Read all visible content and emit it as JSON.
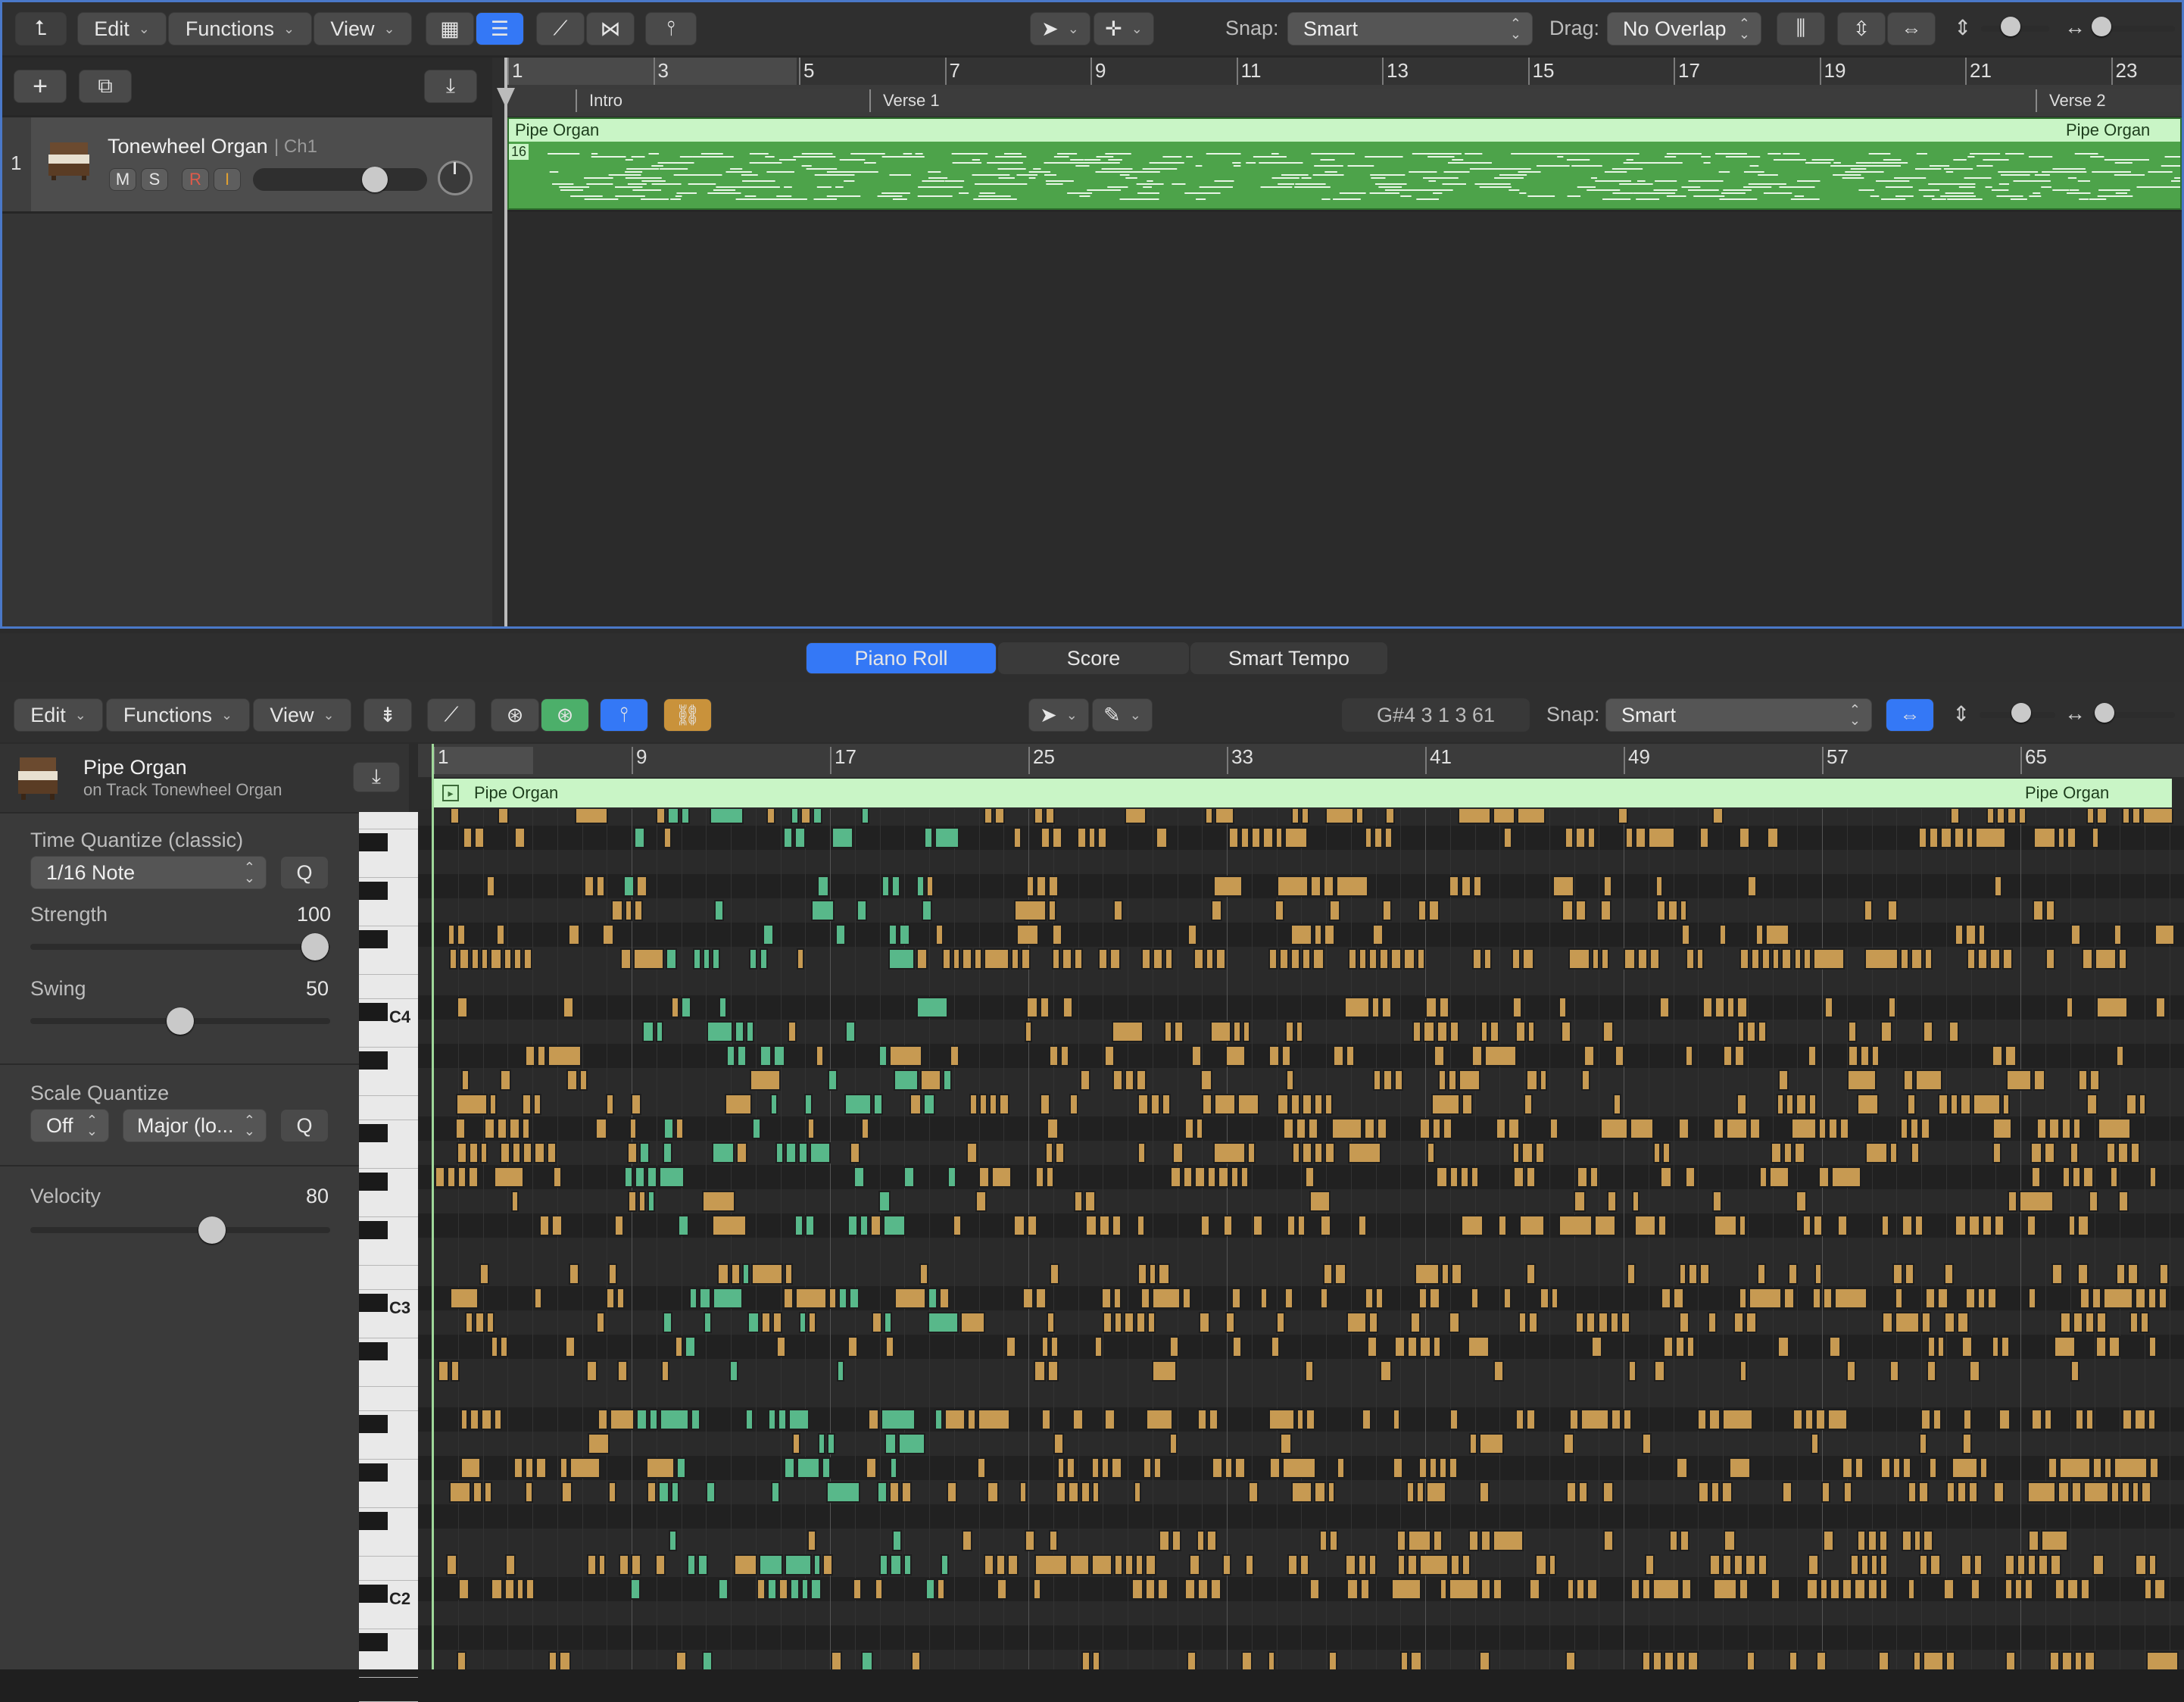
{
  "tracks_toolbar": {
    "edit_label": "Edit",
    "functions_label": "Functions",
    "view_label": "View",
    "snap_label": "Snap:",
    "snap_value": "Smart",
    "drag_label": "Drag:",
    "drag_value": "No Overlap"
  },
  "ruler_top": {
    "bars": [
      "1",
      "3",
      "5",
      "7",
      "9",
      "11",
      "13",
      "15",
      "17",
      "19",
      "21",
      "23"
    ],
    "markers": [
      "Intro",
      "Verse 1",
      "Verse 2"
    ]
  },
  "track": {
    "number": "1",
    "name": "Tonewheel Organ",
    "channel": "| Ch1",
    "mute": "M",
    "solo": "S",
    "record": "R",
    "input": "I"
  },
  "region": {
    "name": "Pipe Organ",
    "name_end": "Pipe Organ",
    "loop_badge": "16"
  },
  "editor_tabs": {
    "piano_roll": "Piano Roll",
    "score": "Score",
    "smart_tempo": "Smart Tempo"
  },
  "piano_toolbar": {
    "edit_label": "Edit",
    "functions_label": "Functions",
    "view_label": "View",
    "position_display": "G#4   3 1 3 61",
    "snap_label": "Snap:",
    "snap_value": "Smart"
  },
  "inspector": {
    "region_name": "Pipe Organ",
    "region_track": "on Track Tonewheel Organ",
    "time_quantize_label": "Time Quantize (classic)",
    "time_quantize_value": "1/16 Note",
    "q_label": "Q",
    "strength_label": "Strength",
    "strength_value": "100",
    "swing_label": "Swing",
    "swing_value": "50",
    "scale_quantize_label": "Scale Quantize",
    "scale_off_value": "Off",
    "scale_type_value": "Major (lo...",
    "velocity_label": "Velocity",
    "velocity_value": "80"
  },
  "ruler_bottom": {
    "bars": [
      "1",
      "9",
      "17",
      "25",
      "33",
      "41",
      "49",
      "57",
      "65"
    ]
  },
  "piano_keys": {
    "c4": "C4",
    "c3": "C3",
    "c2": "C2"
  },
  "colors": {
    "region_green": "#4da34a",
    "region_header": "#c9f5c6",
    "note_gold": "#c79a52",
    "note_green": "#58b88a",
    "accent_blue": "#3478f6",
    "link_gold": "#c9923b"
  }
}
